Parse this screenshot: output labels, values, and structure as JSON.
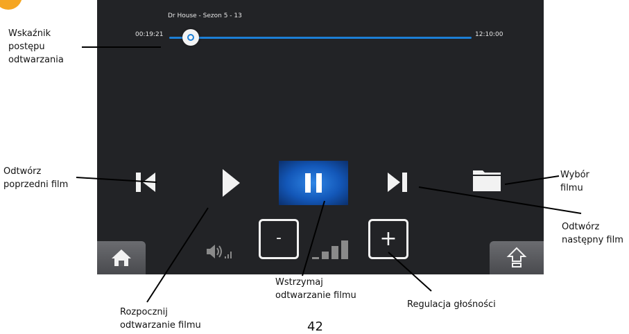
{
  "player": {
    "title": "Dr House - Sezon 5 - 13",
    "time_elapsed": "00:19:21",
    "time_total": "12:10:00",
    "progress_fraction": 0.07
  },
  "volume": {
    "minus_label": "-",
    "plus_label": "+",
    "level_fraction": 0.33
  },
  "labels": {
    "progress_line1": "Wskaźnik",
    "progress_line2": "postępu",
    "progress_line3": "odtwarzania",
    "prev_line1": "Odtwórz",
    "prev_line2": "poprzedni film",
    "select_line1": "Wybór",
    "select_line2": "filmu",
    "next_line1": "Odtwórz",
    "next_line2": "następny film",
    "pause_line1": "Wstrzymaj",
    "pause_line2": "odtwarzanie filmu",
    "volume": "Regulacja głośności",
    "play_line1": "Rozpocznij",
    "play_line2": "odtwarzanie filmu"
  },
  "page_number": "42",
  "icons": {
    "prev": "skip-previous-icon",
    "play": "play-icon",
    "pause": "pause-icon",
    "next": "skip-next-icon",
    "folder": "folder-icon",
    "home": "home-icon",
    "up": "up-arrow-icon",
    "speaker": "speaker-icon",
    "volume_bars": "volume-level-icon"
  },
  "colors": {
    "screen_bg": "#222326",
    "accent": "#1c7fd6",
    "badge": "#f5a623"
  }
}
